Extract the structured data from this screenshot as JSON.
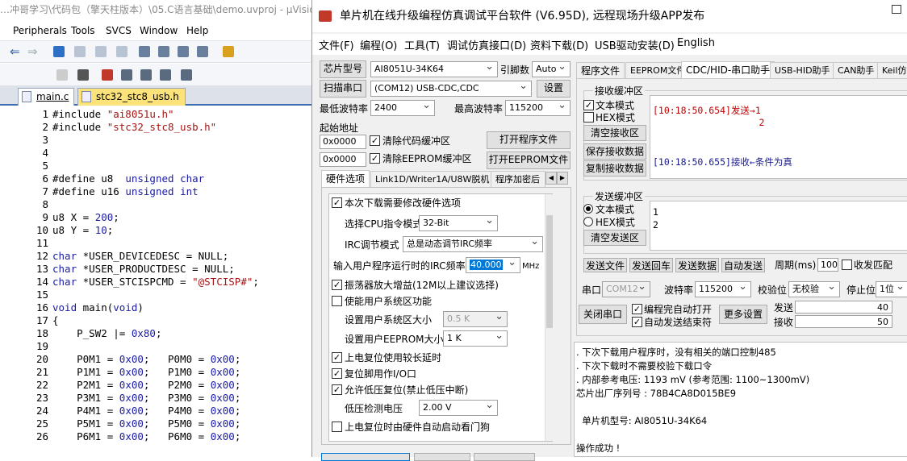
{
  "ide": {
    "title": "…冲哥学习\\代码包（擎天柱版本）\\05.C语言基础\\demo.uvproj - µVision",
    "menu": [
      "Peripherals",
      "Tools",
      "SVCS",
      "Window",
      "Help"
    ],
    "tabs": [
      {
        "label": "main.c"
      },
      {
        "label": "stc32_stc8_usb.h"
      }
    ],
    "code": [
      {
        "n": "1",
        "t": "#include \"ai8051u.h\""
      },
      {
        "n": "2",
        "t": "#include \"stc32_stc8_usb.h\""
      },
      {
        "n": "3",
        "t": ""
      },
      {
        "n": "4",
        "t": ""
      },
      {
        "n": "5",
        "t": ""
      },
      {
        "n": "6",
        "t": "#define u8  unsigned char"
      },
      {
        "n": "7",
        "t": "#define u16 unsigned int"
      },
      {
        "n": "8",
        "t": ""
      },
      {
        "n": "9",
        "t": "u8 X = 200;"
      },
      {
        "n": "10",
        "t": "u8 Y = 10;"
      },
      {
        "n": "11",
        "t": ""
      },
      {
        "n": "12",
        "t": "char *USER_DEVICEDESC = NULL;"
      },
      {
        "n": "13",
        "t": "char *USER_PRODUCTDESC = NULL;"
      },
      {
        "n": "14",
        "t": "char *USER_STCISPCMD = \"@STCISP#\";"
      },
      {
        "n": "15",
        "t": ""
      },
      {
        "n": "16",
        "t": "void main(void)"
      },
      {
        "n": "17",
        "t": "{"
      },
      {
        "n": "18",
        "t": "    P_SW2 |= 0x80;"
      },
      {
        "n": "19",
        "t": ""
      },
      {
        "n": "20",
        "t": "    P0M1 = 0x00;   P0M0 = 0x00;"
      },
      {
        "n": "21",
        "t": "    P1M1 = 0x00;   P1M0 = 0x00;"
      },
      {
        "n": "22",
        "t": "    P2M1 = 0x00;   P2M0 = 0x00;"
      },
      {
        "n": "23",
        "t": "    P3M1 = 0x00;   P3M0 = 0x00;"
      },
      {
        "n": "24",
        "t": "    P4M1 = 0x00;   P4M0 = 0x00;"
      },
      {
        "n": "25",
        "t": "    P5M1 = 0x00;   P5M0 = 0x00;"
      },
      {
        "n": "26",
        "t": "    P6M1 = 0x00;   P6M0 = 0x00;"
      }
    ]
  },
  "dlg": {
    "title": "单片机在线升级编程仿真调试平台软件 (V6.95D), 远程现场升级APP发布",
    "menu": [
      "文件(F)",
      "编程(O)",
      "工具(T)",
      "调试仿真接口(D)",
      "资料下载(D)",
      "USB驱动安装(D)",
      "English"
    ],
    "chip_label": "芯片型号",
    "chip_value": "AI8051U-34K64",
    "pins_label": "引脚数",
    "pins_value": "Auto",
    "scan_button": "扫描串口",
    "port_value": "(COM12) USB-CDC,CDC",
    "settings_button": "设置",
    "min_baud_label": "最低波特率",
    "min_baud_value": "2400",
    "max_baud_label": "最高波特率",
    "max_baud_value": "115200",
    "start_addr_label": "起始地址",
    "addr1": "0x0000",
    "clear_code_label": "清除代码缓冲区",
    "open_prog_button": "打开程序文件",
    "addr2": "0x0000",
    "clear_eeprom_label": "清除EEPROM缓冲区",
    "open_eeprom_button": "打开EEPROM文件",
    "left_tabs": [
      "硬件选项",
      "Link1D/Writer1A/U8W脱机",
      "程序加密后"
    ],
    "hw": {
      "opt1": "本次下载需要修改硬件选项",
      "cpu_mode_label": "选择CPU指令模式",
      "cpu_mode_value": "32-Bit",
      "irc_mode_label": "IRC调节模式",
      "irc_mode_value": "总是动态调节IRC频率",
      "freq_label": "输入用户程序运行时的IRC频率",
      "freq_value": "40.000",
      "freq_unit": "MHz",
      "opt_osc": "振荡器放大增益(12M以上建议选择)",
      "opt_sysarea": "使能用户系统区功能",
      "sysarea_size_label": "设置用户系统区大小",
      "sysarea_size_value": "0.5 K",
      "eeprom_size_label": "设置用户EEPROM大小",
      "eeprom_size_value": "1  K",
      "opt_reset_delay": "上电复位使用较长延时",
      "opt_reset_pin": "复位脚用作I/O口",
      "opt_lvr": "允许低压复位(禁止低压中断)",
      "lvd_label": "低压检测电压",
      "lvd_value": "2.00 V",
      "opt_wdt": "上电复位时由硬件自动启动看门狗"
    },
    "right_tabs": [
      "程序文件",
      "EEPROM文件",
      "CDC/HID-串口助手",
      "USB-HID助手",
      "CAN助手",
      "Keil仿"
    ],
    "rx": {
      "group": "接收缓冲区",
      "text_mode": "文本模式",
      "hex_mode": "HEX模式",
      "clear": "清空接收区",
      "save": "保存接收数据",
      "copy": "复制接收数据",
      "line1": "[10:18:50.654]发送→1",
      "line2": "                   2",
      "line3": "[10:18:50.655]接收←条件为真"
    },
    "tx": {
      "group": "发送缓冲区",
      "text_mode": "文本模式",
      "hex_mode": "HEX模式",
      "clear": "清空发送区",
      "line1": "1",
      "line2": "2"
    },
    "actions": [
      "发送文件",
      "发送回车",
      "发送数据",
      "自动发送"
    ],
    "period_label": "周期(ms)",
    "period_value": "100",
    "match_label": "收发匹配",
    "port_label": "串口",
    "port_com": "COM12",
    "baud_label": "波特率",
    "baud_value": "115200",
    "parity_label": "校验位",
    "parity_value": "无校验",
    "stop_label": "停止位",
    "stop_value": "1位",
    "close_port": "关闭串口",
    "auto_open": "编程完自动打开",
    "auto_send_end": "自动发送结束符",
    "more_settings": "更多设置",
    "send_label": "发送",
    "send_count": "40",
    "recv_label": "接收",
    "recv_count": "50",
    "log": [
      ". 下次下载用户程序时，没有相关的端口控制485",
      ". 下次下载时不需要校验下载口令",
      ". 内部参考电压: 1193 mV (参考范围: 1100~1300mV)",
      "芯片出厂序列号 : 78B4CA8D015BE9",
      "",
      "  单片机型号: AI8051U-34K64",
      "",
      "操作成功 !"
    ]
  }
}
